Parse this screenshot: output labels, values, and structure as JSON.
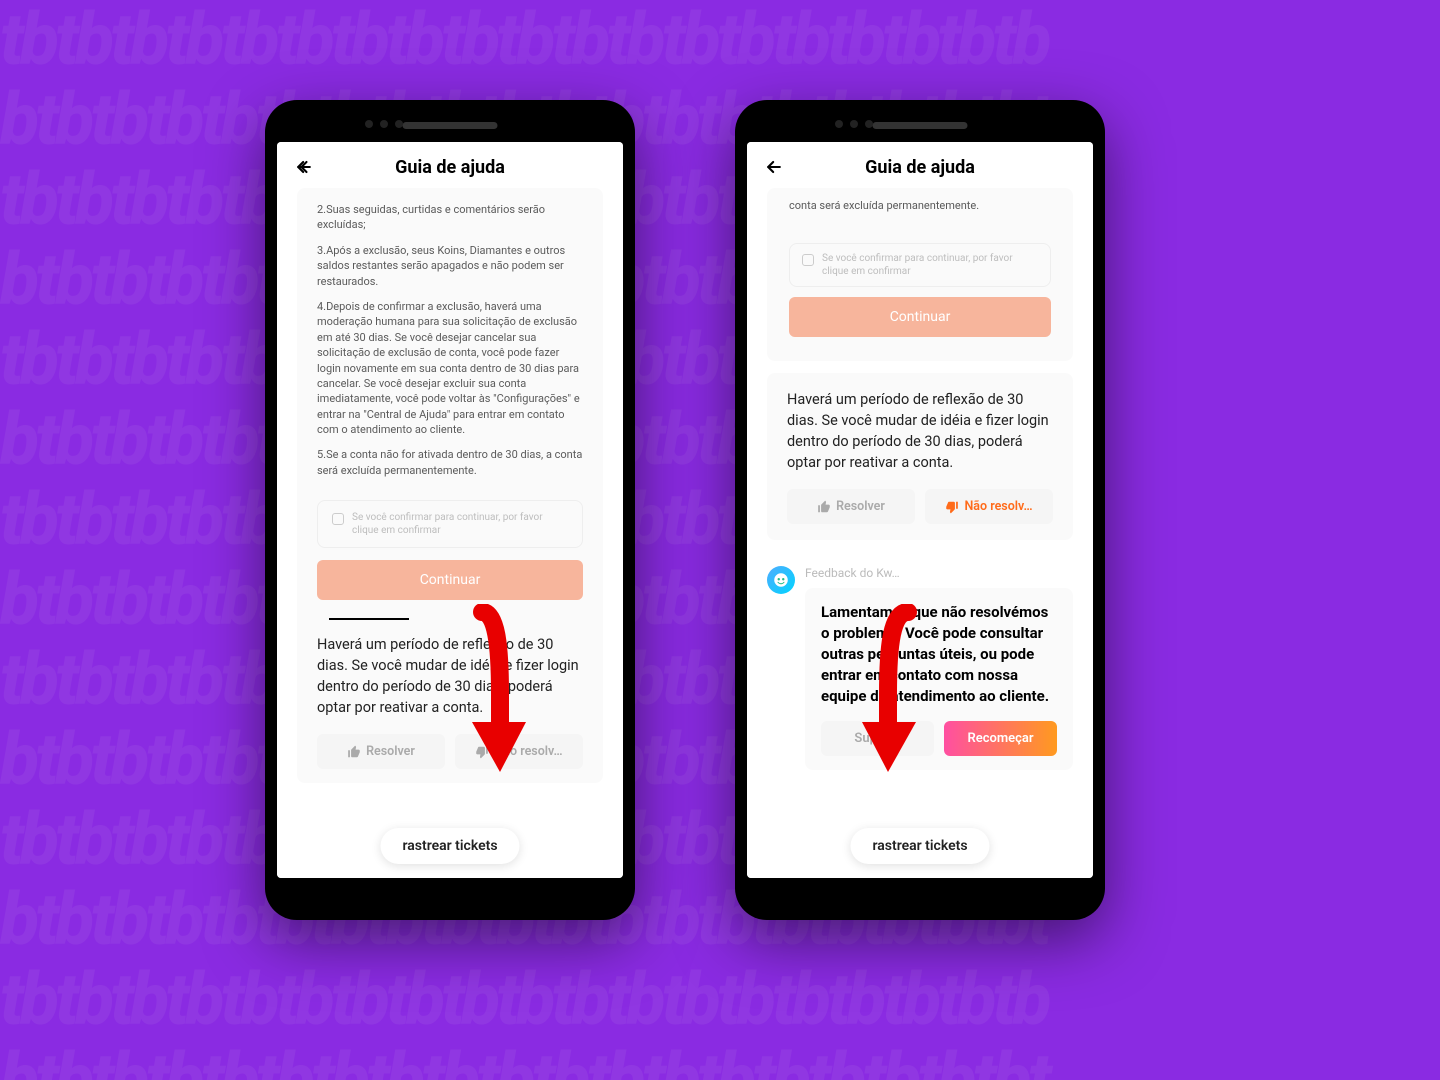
{
  "background_pattern": "tbtbtbtbtbtbtbtbtbtb",
  "header": {
    "title": "Guia de ajuda"
  },
  "left": {
    "para2": "2.Suas seguidas, curtidas e comentários serão excluídas;",
    "para3": "3.Após a exclusão, seus Koins, Diamantes e outros saldos restantes serão apagados e não podem ser restaurados.",
    "para4": "4.Depois de confirmar a exclusão, haverá uma moderação humana para sua solicitação de exclusão em até 30 dias. Se você desejar cancelar sua solicitação de exclusão de conta, você pode fazer login novamente em sua conta dentro de 30 dias para cancelar. Se você desejar excluir sua conta imediatamente, você pode voltar às \"Configurações\" e entrar na \"Central de Ajuda\" para entrar em contato com o atendimento ao cliente.",
    "para5": "5.Se a conta não for ativada dentro de 30 dias, a conta será excluída permanentemente.",
    "confirm_text": "Se você confirmar para continuar, por favor clique em confirmar",
    "continue_label": "Continuar",
    "reflection_text": "Haverá um período de reflexão de 30 dias. Se você mudar de idéia e fizer login dentro do período de 30 dias, poderá optar por reativar a conta.",
    "resolve_label": "Resolver",
    "not_resolve_label": "Não resolv…",
    "track_label": "rastrear tickets"
  },
  "right": {
    "top_fragment": "conta será excluída permanentemente.",
    "confirm_text": "Se você confirmar para continuar, por favor clique em confirmar",
    "continue_label": "Continuar",
    "reflection_text": "Haverá um período de reflexão de 30 dias. Se você mudar de idéia e fizer login dentro do período de 30 dias, poderá optar por reativar a conta.",
    "resolve_label": "Resolver",
    "not_resolve_label": "Não resolv…",
    "feedback_label": "Feedback do Kw…",
    "apology_text": "Lamentamos que não resolvémos o problema. Você pode consultar outras perguntas úteis, ou pode entrar em contato com nossa equipe de atendimento ao cliente.",
    "support_label": "Suporte",
    "restart_label": "Recomeçar",
    "track_label": "rastrear tickets"
  }
}
